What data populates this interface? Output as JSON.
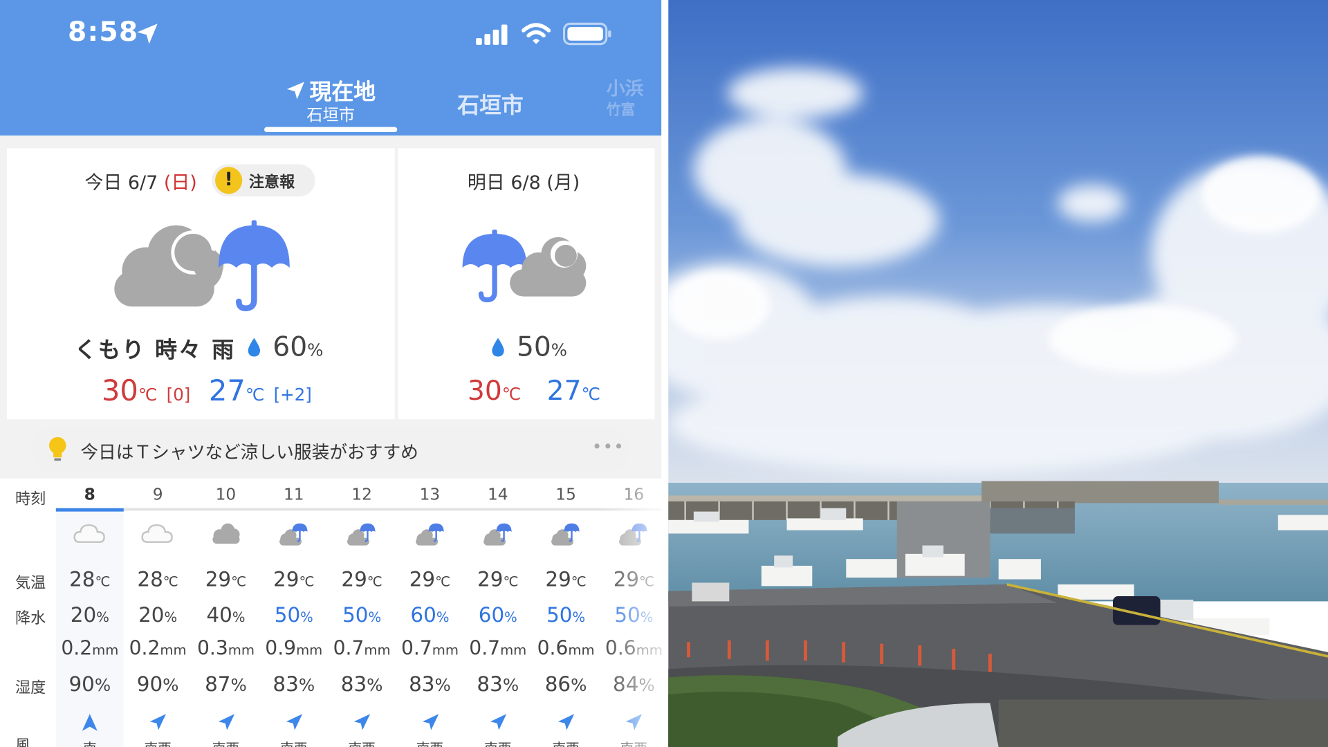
{
  "status": {
    "time": "8:58"
  },
  "tabs": {
    "current_label": "現在地",
    "current_sub": "石垣市",
    "second": "石垣市",
    "third": "小浜",
    "third_sub": "竹富"
  },
  "today": {
    "date": "今日 6/7",
    "dow": "(日)",
    "warning": "注意報",
    "warning_icon": "!",
    "condition": "くもり 時々 雨",
    "pop": "60",
    "pop_unit": "%",
    "high": "30",
    "high_unit": "℃",
    "high_diff": "[0]",
    "low": "27",
    "low_unit": "℃",
    "low_diff": "[+2]"
  },
  "tomorrow": {
    "date": "明日 6/8 (月)",
    "pop": "50",
    "pop_unit": "%",
    "high": "30",
    "high_unit": "℃",
    "low": "27",
    "low_unit": "℃"
  },
  "tip": {
    "text": "今日はＴシャツなど涼しい服装がおすすめ",
    "more": "•••"
  },
  "hourly": {
    "labels": {
      "time": "時刻",
      "temp": "気温",
      "precip": "降水",
      "humidity": "湿度",
      "wind": "風"
    },
    "hours": [
      {
        "h": "8",
        "icon": "cloud-icon",
        "t": "28",
        "p": "20",
        "mm": "0.2",
        "hum": "90",
        "wind": "up"
      },
      {
        "h": "9",
        "icon": "cloud-icon",
        "t": "28",
        "p": "20",
        "mm": "0.2",
        "hum": "90",
        "wind": "ne"
      },
      {
        "h": "10",
        "icon": "cloudy-icon",
        "t": "29",
        "p": "40",
        "mm": "0.3",
        "hum": "87",
        "wind": "ne"
      },
      {
        "h": "11",
        "icon": "cloud-rain-icon",
        "t": "29",
        "p": "50",
        "mm": "0.9",
        "hum": "83",
        "wind": "ne"
      },
      {
        "h": "12",
        "icon": "cloud-rain-icon",
        "t": "29",
        "p": "50",
        "mm": "0.7",
        "hum": "83",
        "wind": "ne"
      },
      {
        "h": "13",
        "icon": "cloud-rain-icon",
        "t": "29",
        "p": "60",
        "mm": "0.7",
        "hum": "83",
        "wind": "ne"
      },
      {
        "h": "14",
        "icon": "cloud-rain-icon",
        "t": "29",
        "p": "60",
        "mm": "0.7",
        "hum": "83",
        "wind": "ne"
      },
      {
        "h": "15",
        "icon": "cloud-rain-icon",
        "t": "29",
        "p": "50",
        "mm": "0.6",
        "hum": "86",
        "wind": "ne"
      },
      {
        "h": "16",
        "icon": "cloud-rain-icon",
        "t": "29",
        "p": "50",
        "mm": "0.6",
        "hum": "84",
        "wind": "ne"
      }
    ],
    "units": {
      "temp": "℃",
      "pct": "%",
      "mm": "mm"
    },
    "wind_dirs": [
      "南",
      "南西",
      "南西",
      "南西",
      "南西",
      "南西",
      "南西",
      "南西",
      "南西"
    ]
  },
  "colors": {
    "header": "#5b97e6",
    "high": "#d03b3b",
    "low": "#2f74e0",
    "umbrella": "#5a86f0",
    "cloud": "#a9a9a9"
  }
}
